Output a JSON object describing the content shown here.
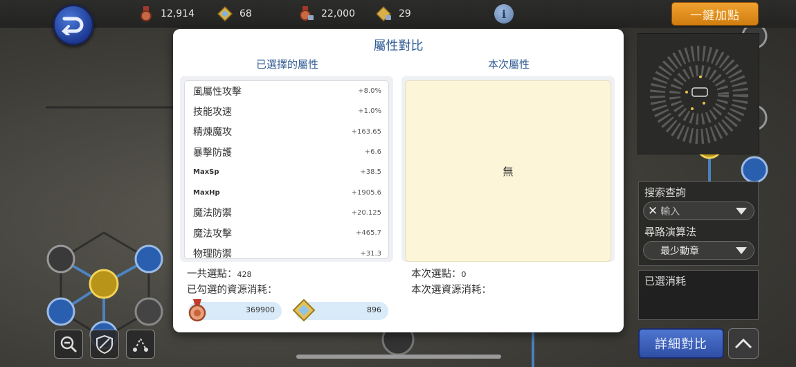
{
  "topbar": {
    "resources": [
      {
        "icon": "red-medal-icon",
        "value": "12,914"
      },
      {
        "icon": "gold-crystal-icon",
        "value": "68"
      },
      {
        "icon": "locked-medal-icon",
        "value": "22,000"
      },
      {
        "icon": "locked-crystal-icon",
        "value": "29"
      }
    ],
    "one_key_label": "一鍵加點"
  },
  "modal": {
    "title": "屬性對比",
    "left_title": "已選擇的屬性",
    "right_title": "本次屬性",
    "attributes": [
      {
        "name": "風屬性攻擊",
        "value": "+8.0%"
      },
      {
        "name": "技能攻速",
        "value": "+1.0%"
      },
      {
        "name": "精煉魔攻",
        "value": "+163.65"
      },
      {
        "name": "暴擊防護",
        "value": "+6.6"
      },
      {
        "name": "MaxSp",
        "value": "+38.5"
      },
      {
        "name": "MaxHp",
        "value": "+1905.6"
      },
      {
        "name": "魔法防禦",
        "value": "+20.125"
      },
      {
        "name": "魔法攻擊",
        "value": "+465.7"
      },
      {
        "name": "物理防禦",
        "value": "+31.3"
      }
    ],
    "current_empty": "無",
    "total_points_label": "一共選點：",
    "total_points_value": "428",
    "checked_cost_label": "已勾選的資源消耗：",
    "cost_medal": "369900",
    "cost_crystal": "896",
    "current_points_label": "本次選點：",
    "current_points_value": "0",
    "current_cost_label": "本次選資源消耗："
  },
  "side": {
    "search_label": "搜索查詢",
    "search_placeholder": "輸入",
    "path_label": "尋路演算法",
    "path_value": "最少動章",
    "selected_cost_label": "已選消耗",
    "detail_button": "詳細對比"
  },
  "colors": {
    "accent": "#2e5a93",
    "orange_button": "#e5921f",
    "blue_button": "#3e62bd",
    "highlight_panel": "#fdf5d8"
  }
}
